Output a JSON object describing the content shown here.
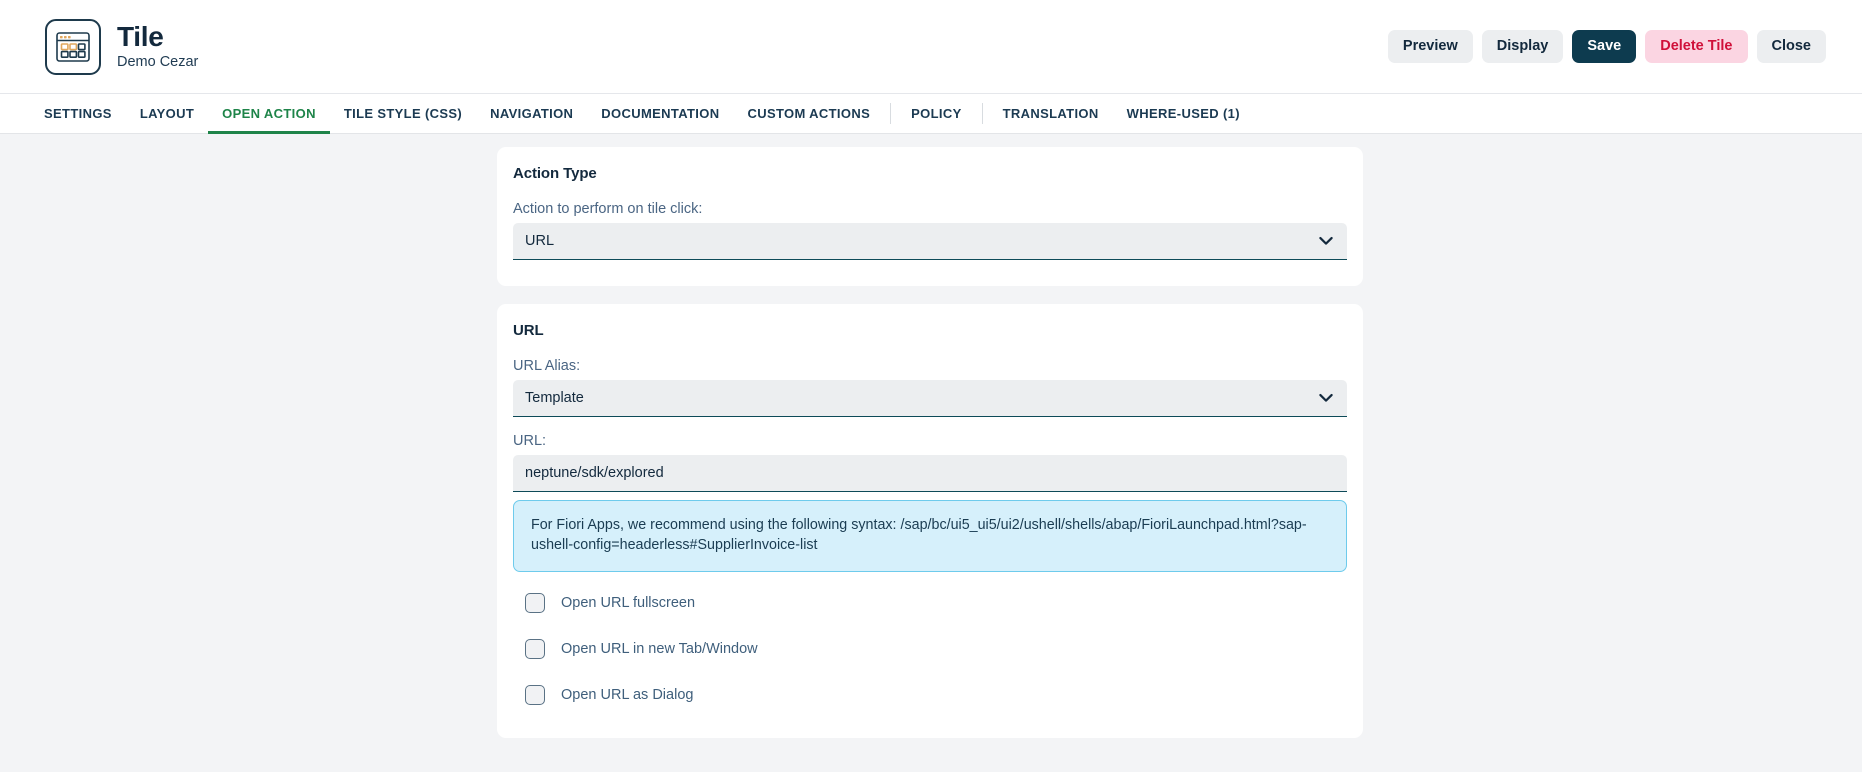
{
  "header": {
    "icon": "tile-grid-window-icon",
    "title": "Tile",
    "subtitle": "Demo Cezar",
    "buttons": [
      {
        "label": "Preview",
        "style": "neutral",
        "name": "preview-button"
      },
      {
        "label": "Display",
        "style": "neutral",
        "name": "display-button"
      },
      {
        "label": "Save",
        "style": "primary",
        "name": "save-button"
      },
      {
        "label": "Delete Tile",
        "style": "danger",
        "name": "delete-tile-button"
      },
      {
        "label": "Close",
        "style": "neutral",
        "name": "close-button"
      }
    ]
  },
  "tabs": [
    {
      "label": "SETTINGS",
      "active": false
    },
    {
      "label": "LAYOUT",
      "active": false
    },
    {
      "label": "OPEN ACTION",
      "active": true
    },
    {
      "label": "TILE STYLE (CSS)",
      "active": false
    },
    {
      "label": "NAVIGATION",
      "active": false
    },
    {
      "label": "DOCUMENTATION",
      "active": false
    },
    {
      "label": "CUSTOM ACTIONS",
      "active": false
    },
    {
      "label": "POLICY",
      "active": false
    },
    {
      "label": "TRANSLATION",
      "active": false
    },
    {
      "label": "WHERE-USED (1)",
      "active": false
    }
  ],
  "action_type_card": {
    "title": "Action Type",
    "field_label": "Action to perform on tile click:",
    "value": "URL",
    "options": [
      "URL"
    ]
  },
  "url_card": {
    "title": "URL",
    "alias_label": "URL Alias:",
    "alias_value": "Template",
    "alias_options": [
      "Template"
    ],
    "url_label": "URL:",
    "url_value": "neptune/sdk/explored",
    "url_placeholder": "",
    "info_text": "For Fiori Apps, we recommend using the following syntax: /sap/bc/ui5_ui5/ui2/ushell/shells/abap/FioriLaunchpad.html?sap-ushell-config=headerless#SupplierInvoice-list",
    "checkboxes": [
      {
        "label": "Open URL fullscreen",
        "checked": false,
        "name": "checkbox-open-url-fullscreen"
      },
      {
        "label": "Open URL in new Tab/Window",
        "checked": false,
        "name": "checkbox-open-url-new-tab"
      },
      {
        "label": "Open URL as Dialog",
        "checked": false,
        "name": "checkbox-open-url-dialog"
      }
    ]
  },
  "colors": {
    "accent_green": "#1e8449",
    "primary_navy": "#0d3b4f",
    "danger_red": "#d0103a",
    "danger_bg": "#fbd5e2",
    "info_bg": "#d6f0fb",
    "page_bg": "#f3f4f6"
  }
}
